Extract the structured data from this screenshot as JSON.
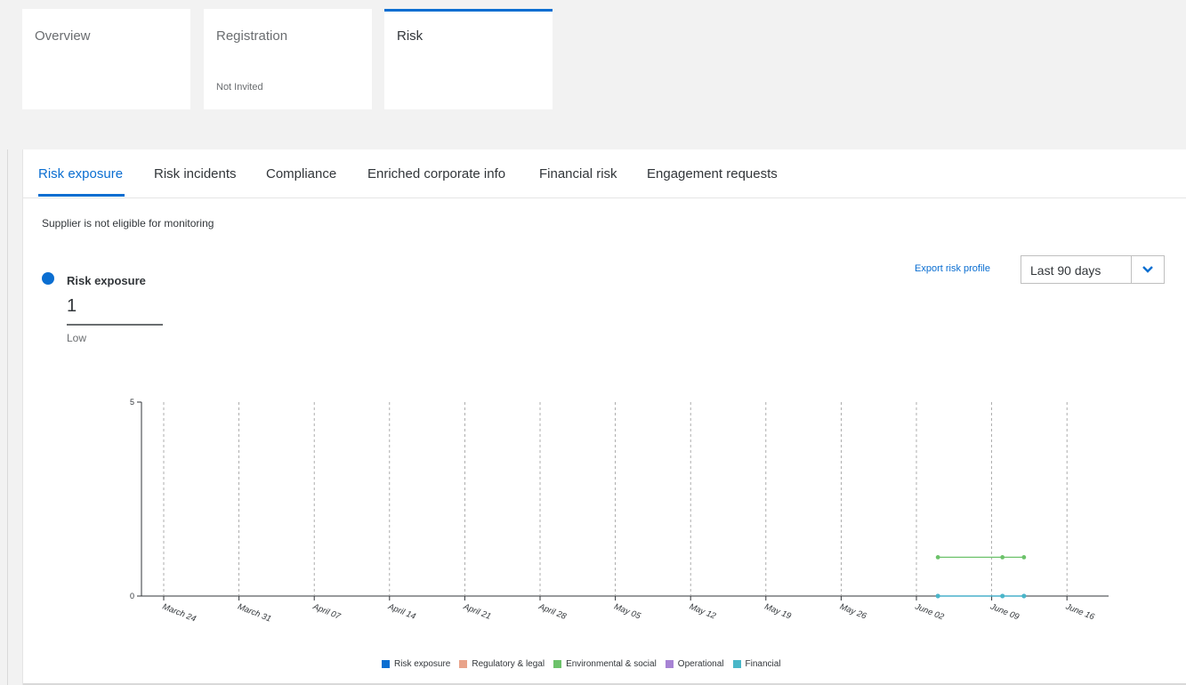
{
  "header_cards": [
    {
      "title": "Overview",
      "subtitle": ""
    },
    {
      "title": "Registration",
      "subtitle": "Not Invited"
    },
    {
      "title": "Risk",
      "subtitle": ""
    }
  ],
  "tabs": [
    {
      "label": "Risk exposure",
      "active": true
    },
    {
      "label": "Risk incidents",
      "active": false
    },
    {
      "label": "Compliance",
      "active": false
    },
    {
      "label": "Enriched corporate info",
      "active": false
    },
    {
      "label": "Financial risk",
      "active": false
    },
    {
      "label": "Engagement requests",
      "active": false
    }
  ],
  "notice": "Supplier is not eligible for monitoring",
  "risk_summary": {
    "title": "Risk exposure",
    "score": "1",
    "level": "Low",
    "dot_color": "#0a6ed1"
  },
  "export_link": "Export risk profile",
  "period_select": {
    "value": "Last 90 days",
    "icon": "chevron-down-icon"
  },
  "chart_data": {
    "type": "line",
    "x_ticks": [
      "March 24",
      "March 31",
      "April 07",
      "April 14",
      "April 21",
      "April 28",
      "May 05",
      "May 12",
      "May 19",
      "May 26",
      "June 02",
      "June 09",
      "June 16"
    ],
    "y_ticks": [
      "0",
      "5"
    ],
    "ylim": [
      0,
      5
    ],
    "grid": "vertical dashed",
    "legend_position": "bottom",
    "series": [
      {
        "name": "Risk exposure",
        "color": "#0a6ed1",
        "points": [
          {
            "x": "June 04",
            "y": 0
          },
          {
            "x": "June 10",
            "y": 0
          },
          {
            "x": "June 12",
            "y": 0
          }
        ]
      },
      {
        "name": "Regulatory & legal",
        "color": "#e9a38a",
        "points": []
      },
      {
        "name": "Environmental & social",
        "color": "#6cc26a",
        "points": [
          {
            "x": "June 04",
            "y": 1
          },
          {
            "x": "June 10",
            "y": 1
          },
          {
            "x": "June 12",
            "y": 1
          }
        ]
      },
      {
        "name": "Operational",
        "color": "#a783d4",
        "points": []
      },
      {
        "name": "Financial",
        "color": "#4ab7c8",
        "points": [
          {
            "x": "June 04",
            "y": 0
          },
          {
            "x": "June 10",
            "y": 0
          },
          {
            "x": "June 12",
            "y": 0
          }
        ]
      }
    ]
  }
}
